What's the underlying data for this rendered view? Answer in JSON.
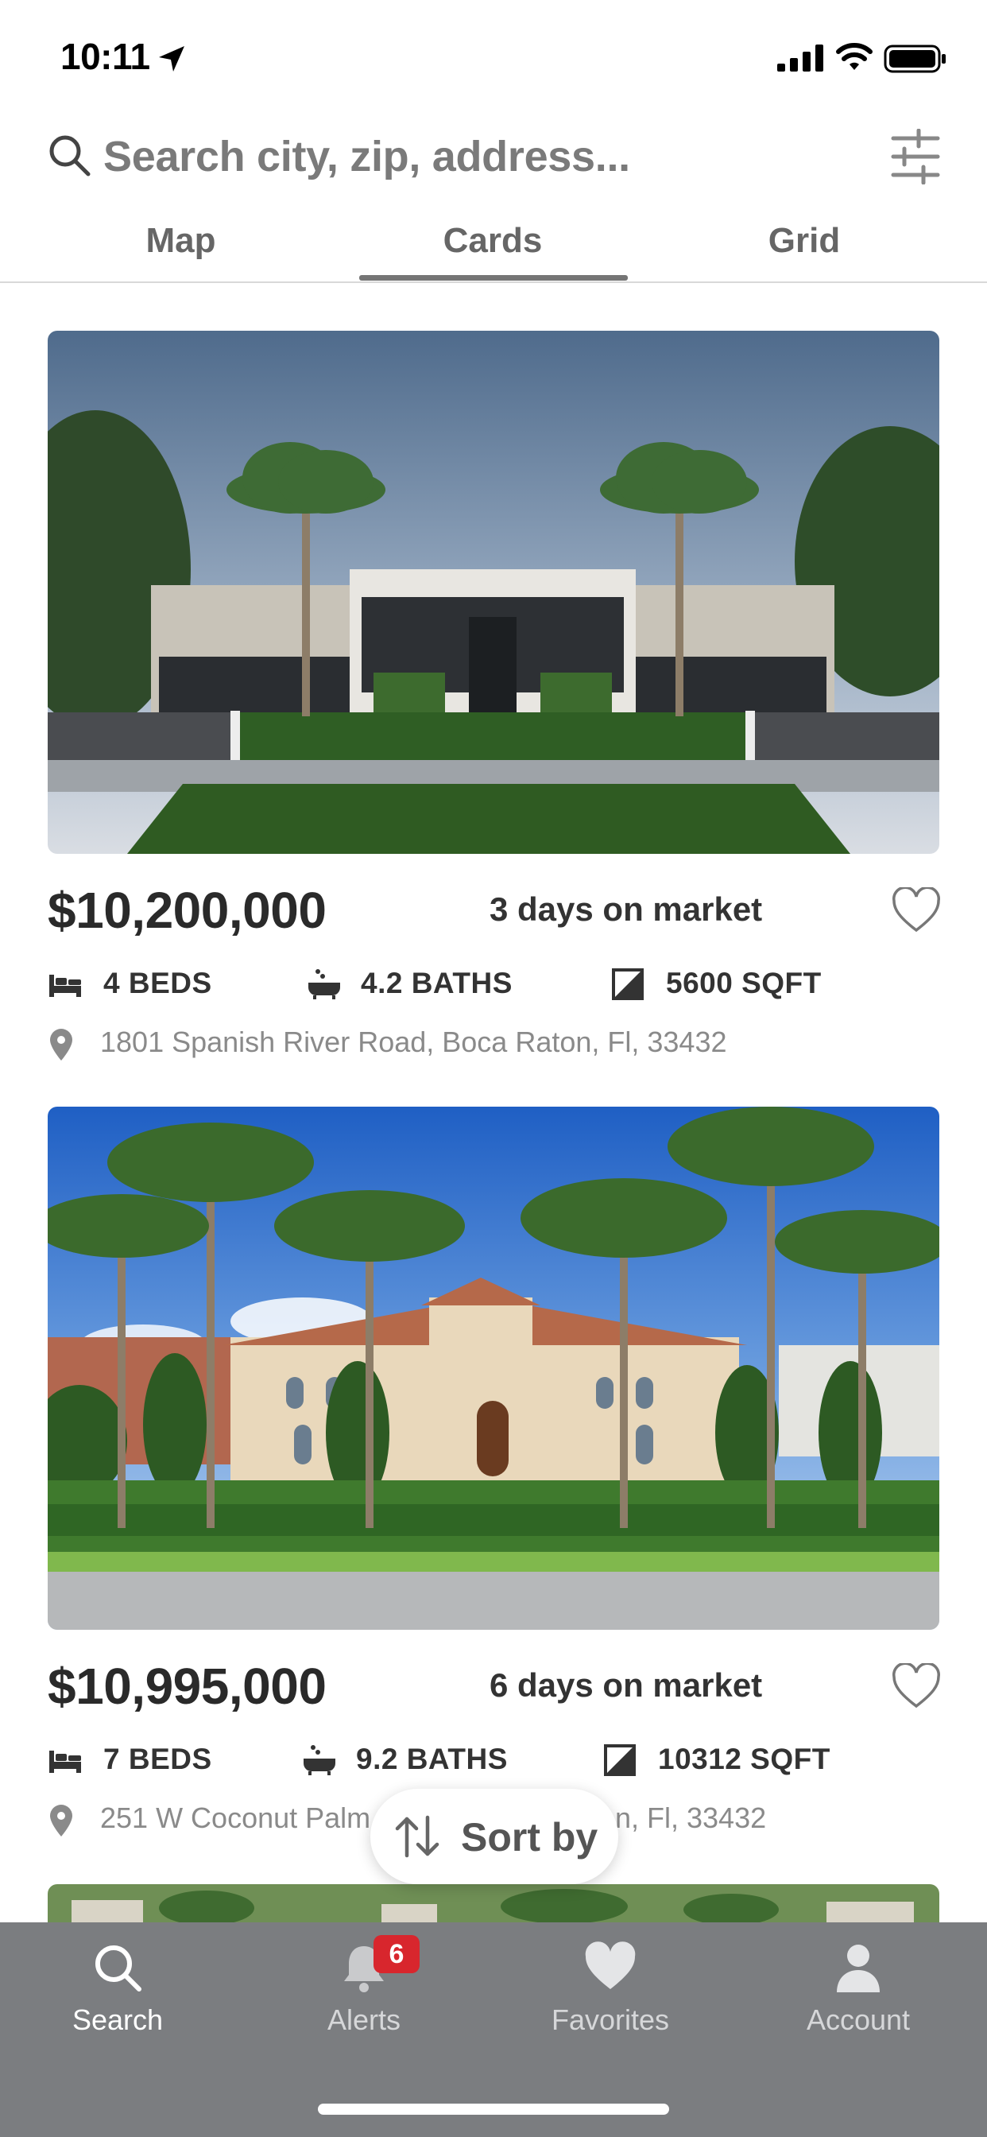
{
  "status_bar": {
    "time": "10:11"
  },
  "search": {
    "placeholder": "Search city, zip, address..."
  },
  "tabs": [
    {
      "label": "Map",
      "active": false
    },
    {
      "label": "Cards",
      "active": true
    },
    {
      "label": "Grid",
      "active": false
    }
  ],
  "listings": [
    {
      "price": "$10,200,000",
      "days_on_market": "3 days on market",
      "beds": "4 BEDS",
      "baths": "4.2 BATHS",
      "sqft": "5600 SQFT",
      "address": "1801 Spanish River Road, Boca Raton, Fl, 33432",
      "favorited": false
    },
    {
      "price": "$10,995,000",
      "days_on_market": "6 days on market",
      "beds": "7 BEDS",
      "baths": "9.2 BATHS",
      "sqft": "10312 SQFT",
      "address": "251 W Coconut Palm Road, Boca Raton, Fl, 33432",
      "address_visible_start": "251 W Coconut Palm",
      "address_visible_end": "n, Fl, 33432",
      "favorited": false
    }
  ],
  "sort_button": {
    "label": "Sort by"
  },
  "tab_bar": [
    {
      "label": "Search",
      "icon": "search-icon",
      "active": true
    },
    {
      "label": "Alerts",
      "icon": "bell-icon",
      "badge": "6",
      "active": false
    },
    {
      "label": "Favorites",
      "icon": "heart-icon",
      "active": false
    },
    {
      "label": "Account",
      "icon": "person-icon",
      "active": false
    }
  ],
  "colors": {
    "tab_bar_bg": "#7b7d80",
    "badge": "#d8262d",
    "text_dark": "#2a2a2a",
    "text_muted": "#8a8a8a"
  }
}
